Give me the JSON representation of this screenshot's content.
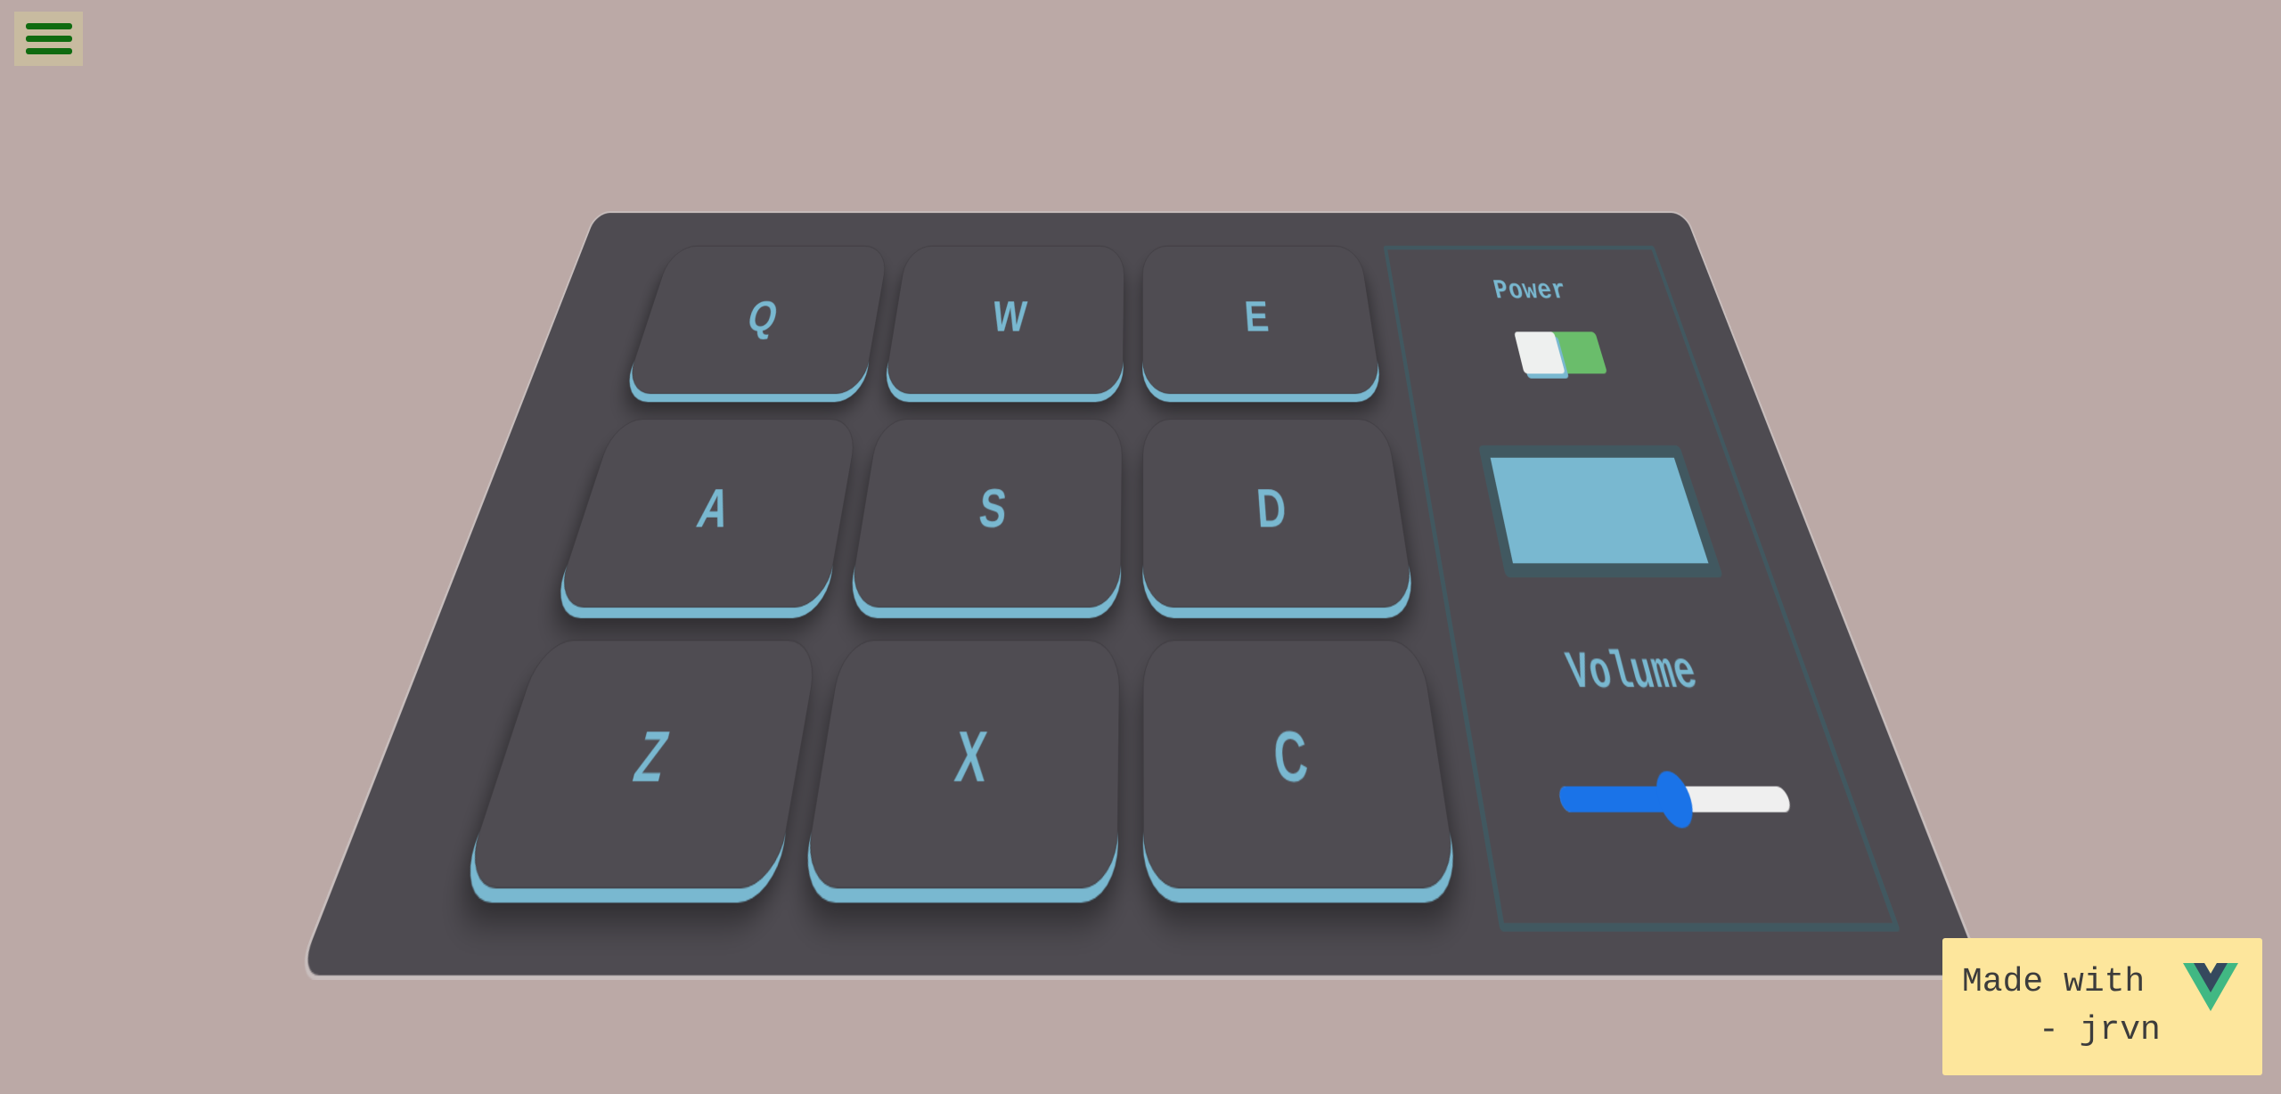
{
  "menu": {
    "icon": "hamburger-menu-icon",
    "icon_color": "#0f6b10"
  },
  "drum_machine": {
    "pads": [
      {
        "key": "Q"
      },
      {
        "key": "W"
      },
      {
        "key": "E"
      },
      {
        "key": "A"
      },
      {
        "key": "S"
      },
      {
        "key": "D"
      },
      {
        "key": "Z"
      },
      {
        "key": "X"
      },
      {
        "key": "C"
      }
    ],
    "controls": {
      "power_label": "Power",
      "power_on": true,
      "display_text": "",
      "volume_label": "Volume",
      "volume_level": 0.5
    }
  },
  "colors": {
    "background": "#bba9a6",
    "board": "#4e4b51",
    "accent": "#79b8d0",
    "power_on": "#6abd6b",
    "slider": "#1a73e8",
    "credit_bg": "#fde69c"
  },
  "credit": {
    "line1": "Made with",
    "line2": "- jrvn",
    "logo": "vue-logo-icon"
  }
}
